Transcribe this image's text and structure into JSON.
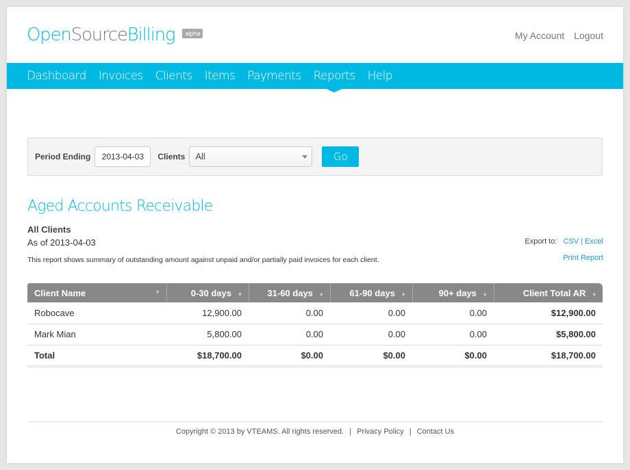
{
  "brand": {
    "name_part1": "Open",
    "name_part2": "Source",
    "name_part3": "Billing",
    "badge": "alpha"
  },
  "toplinks": {
    "my_account": "My Account",
    "logout": "Logout"
  },
  "nav": [
    "Dashboard",
    "Invoices",
    "Clients",
    "Items",
    "Payments",
    "Reports",
    "Help"
  ],
  "nav_active": "Reports",
  "filter": {
    "period_label": "Period Ending",
    "period_value": "2013-04-03",
    "clients_label": "Clients",
    "clients_value": "All",
    "go_label": "Go"
  },
  "report": {
    "title": "Aged Accounts Receivable",
    "subtitle": "All Clients",
    "as_of": "As of 2013-04-03",
    "description": "This report shows summary of outstanding amount against unpaid and/or partially paid invoices for each client.",
    "export_label": "Export to:",
    "export_csv": "CSV",
    "export_separator": "|",
    "export_excel": "Excel",
    "print": "Print Report"
  },
  "table": {
    "columns": [
      "Client Name",
      "0-30 days",
      "31-60 days",
      "61-90 days",
      "90+ days",
      "Client Total AR"
    ],
    "sort_icons": [
      "♦",
      "▾",
      "♦",
      "♦",
      "♦",
      "♦"
    ],
    "rows": [
      [
        "Robocave",
        "12,900.00",
        "0.00",
        "0.00",
        "0.00",
        "$12,900.00"
      ],
      [
        "Mark Mian",
        "5,800.00",
        "0.00",
        "0.00",
        "0.00",
        "$5,800.00"
      ]
    ],
    "total": [
      "Total",
      "$18,700.00",
      "$0.00",
      "$0.00",
      "$0.00",
      "$18,700.00"
    ]
  },
  "footer": {
    "copyright": "Copyright © 2013 by VTEAMS. All rights reserved.",
    "separator": "|",
    "privacy": "Privacy Policy",
    "contact": "Contact Us"
  }
}
